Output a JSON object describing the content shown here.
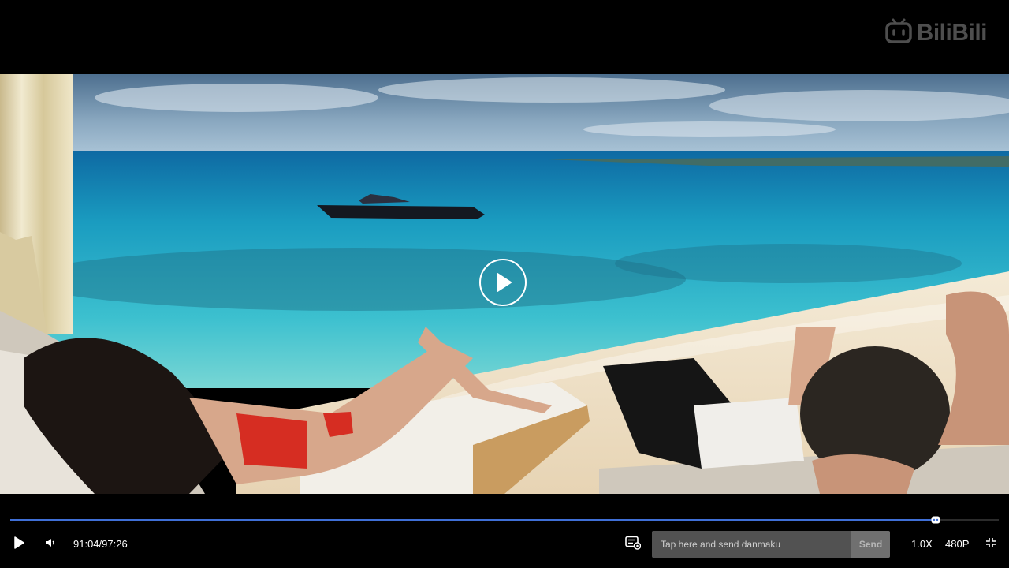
{
  "logo": {
    "text": "BiliBili",
    "icon": "tv-logo-icon"
  },
  "video": {
    "description_icon": "video-frame",
    "play_overlay_icon": "play-circle-icon"
  },
  "progress": {
    "played_fraction": 0.936,
    "thumb_icon": "progress-thumb-icon"
  },
  "controls": {
    "play_icon": "play-icon",
    "volume_icon": "volume-icon",
    "current_time": "91:04",
    "separator": "/",
    "total_time": "97:26",
    "danmaku_toggle_icon": "danmaku-settings-icon",
    "danmaku_placeholder": "Tap here and send danmaku",
    "send_label": "Send",
    "speed": "1.0X",
    "quality": "480P",
    "fullscreen_icon": "exit-fullscreen-icon"
  },
  "colors": {
    "accent": "#3f6fd6",
    "background": "#000000",
    "input_bg": "#525252",
    "send_bg": "#707070"
  }
}
